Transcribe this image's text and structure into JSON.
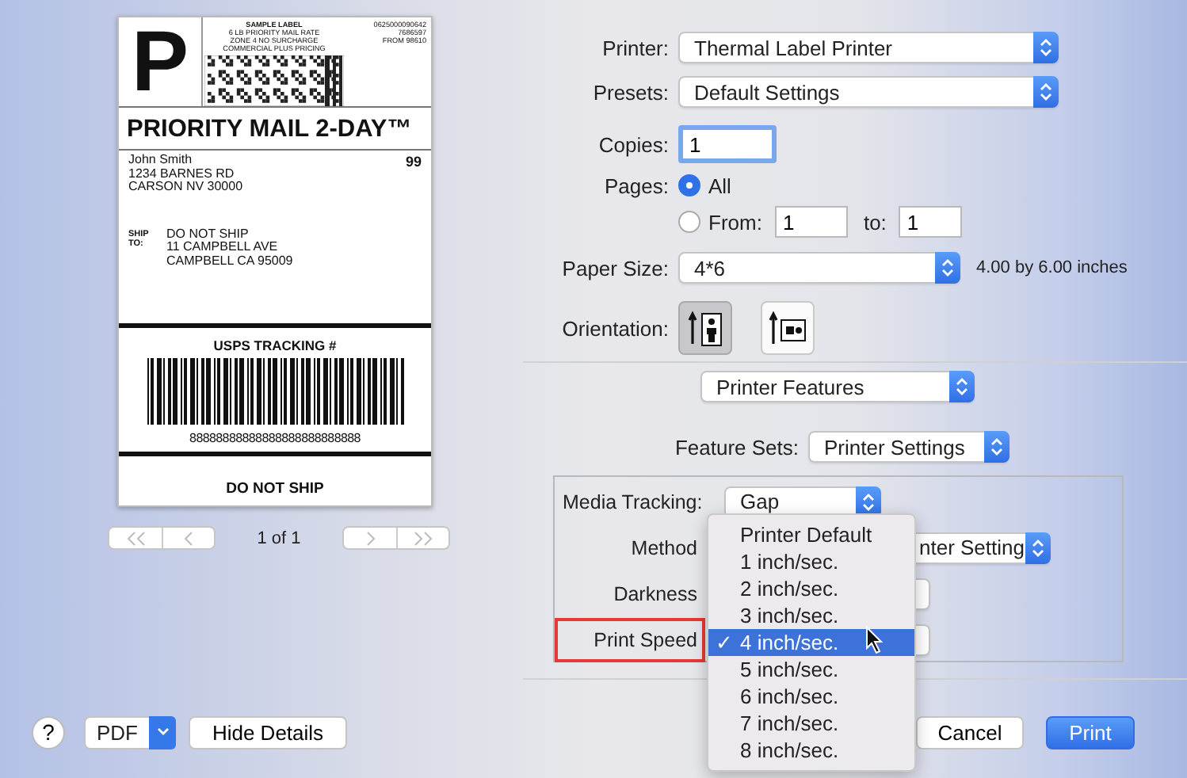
{
  "preview": {
    "letter": "P",
    "header_lines": [
      "SAMPLE LABEL",
      "6 LB PRIORITY MAIL RATE",
      "ZONE 4 NO SURCHARGE",
      "COMMERCIAL PLUS PRICING"
    ],
    "code_lines": [
      "0625000090642",
      "7686597",
      "FROM 98610"
    ],
    "service": "PRIORITY MAIL 2-DAY™",
    "from_lines": [
      "John Smith",
      "1234 BARNES RD",
      "CARSON NV 30000"
    ],
    "zone": "99",
    "ship_to_label_lines": [
      "SHIP",
      "TO:"
    ],
    "ship_to_lines": [
      "DO NOT SHIP",
      "11 CAMPBELL AVE",
      "CAMPBELL CA 95009"
    ],
    "tracking_title": "USPS TRACKING #",
    "tracking_number": "88888888888888888888888888",
    "footer": "DO NOT SHIP",
    "page_indicator": "1 of 1"
  },
  "printer": {
    "label": "Printer:",
    "value": "Thermal Label Printer"
  },
  "presets": {
    "label": "Presets:",
    "value": "Default Settings"
  },
  "copies": {
    "label": "Copies:",
    "value": "1"
  },
  "pages": {
    "label": "Pages:",
    "options": [
      {
        "label": "All",
        "selected": true
      },
      {
        "label": "From:",
        "selected": false
      }
    ],
    "from": "1",
    "to_label": "to:",
    "to": "1"
  },
  "paper_size": {
    "label": "Paper Size:",
    "value": "4*6",
    "note": "4.00 by 6.00 inches"
  },
  "orientation": {
    "label": "Orientation:",
    "options": [
      {
        "kind": "portrait",
        "selected": true
      },
      {
        "kind": "landscape",
        "selected": false
      }
    ]
  },
  "section": {
    "value": "Printer Features"
  },
  "feature_sets": {
    "label": "Feature Sets:",
    "value": "Printer Settings"
  },
  "features": [
    {
      "label": "Media Tracking:",
      "value": "Gap",
      "highlighted": false
    },
    {
      "label": "Method",
      "value": "nter Setting",
      "highlighted": false
    },
    {
      "label": "Darkness",
      "highlighted": false
    },
    {
      "label": "Print Speed",
      "highlighted": true
    }
  ],
  "menu": {
    "items": [
      {
        "label": "Printer Default",
        "selected": false
      },
      {
        "label": "1 inch/sec.",
        "selected": false
      },
      {
        "label": "2 inch/sec.",
        "selected": false
      },
      {
        "label": "3 inch/sec.",
        "selected": false
      },
      {
        "label": "4 inch/sec.",
        "selected": true
      },
      {
        "label": "5 inch/sec.",
        "selected": false
      },
      {
        "label": "6 inch/sec.",
        "selected": false
      },
      {
        "label": "7 inch/sec.",
        "selected": false
      },
      {
        "label": "8 inch/sec.",
        "selected": false
      }
    ],
    "check": "✓"
  },
  "bottom": {
    "help": "?",
    "pdf": "PDF",
    "hide_details": "Hide Details",
    "cancel": "Cancel",
    "print": "Print"
  }
}
